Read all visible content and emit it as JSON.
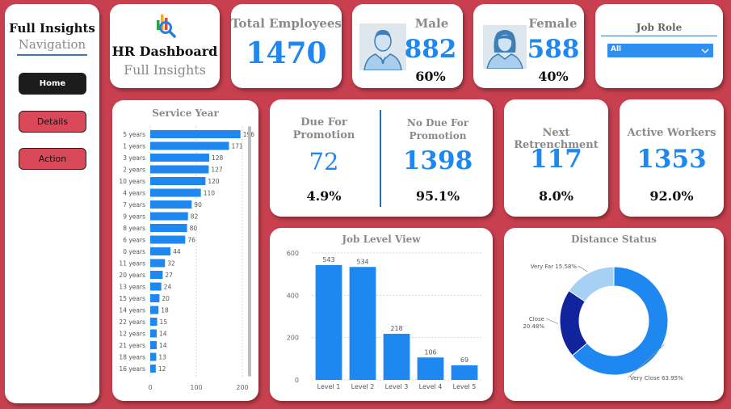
{
  "nav": {
    "title": "Full Insights",
    "subtitle": "Navigation",
    "buttons": [
      "Home",
      "Details",
      "Action"
    ]
  },
  "hr": {
    "title": "HR Dashboard",
    "subtitle": "Full Insights",
    "icon": "analytics-search-icon"
  },
  "total": {
    "label": "Total Employees",
    "value": "1470"
  },
  "male": {
    "label": "Male",
    "value": "882",
    "pct": "60%",
    "icon": "male-avatar-icon"
  },
  "female": {
    "label": "Female",
    "value": "588",
    "pct": "40%",
    "icon": "female-avatar-icon"
  },
  "jobrole": {
    "label": "Job Role",
    "selected": "All"
  },
  "promotion": {
    "due_label": "Due For Promotion",
    "due_value": "72",
    "due_pct": "4.9%",
    "nodue_label": "No Due For Promotion",
    "nodue_value": "1398",
    "nodue_pct": "95.1%"
  },
  "retrench": {
    "label": "Next Retrenchment",
    "value": "117",
    "pct": "8.0%"
  },
  "active": {
    "label": "Active Workers",
    "value": "1353",
    "pct": "92.0%"
  },
  "colors": {
    "accent": "#1e88f0",
    "background": "#c8404f",
    "dark_blue": "#12239e",
    "light_blue": "#a7d0f5"
  },
  "chart_data": [
    {
      "type": "bar",
      "orientation": "horizontal",
      "title": "Service Year",
      "categories": [
        "5 years",
        "1 years",
        "3 years",
        "2 years",
        "10 years",
        "4 years",
        "7 years",
        "9 years",
        "8 years",
        "6 years",
        "0 years",
        "11 years",
        "20 years",
        "13 years",
        "15 years",
        "14 years",
        "22 years",
        "12 years",
        "21 years",
        "18 years",
        "16 years"
      ],
      "values": [
        196,
        171,
        128,
        127,
        120,
        110,
        90,
        82,
        80,
        76,
        44,
        32,
        27,
        24,
        20,
        18,
        15,
        14,
        14,
        13,
        12
      ],
      "data_labels": [
        "196",
        "171",
        "128",
        "127",
        "120",
        "110",
        "90",
        "82",
        "80",
        "76",
        "44",
        "32",
        "27",
        "24",
        "20",
        "18",
        "15",
        "14",
        "14",
        "13",
        "12"
      ],
      "xlim": [
        0,
        200
      ],
      "xticks": [
        "0",
        "100",
        "200"
      ]
    },
    {
      "type": "bar",
      "title": "Job Level View",
      "categories": [
        "Level 1",
        "Level 2",
        "Level 3",
        "Level 4",
        "Level 5"
      ],
      "values": [
        543,
        534,
        218,
        106,
        69
      ],
      "ylim": [
        0,
        600
      ],
      "yticks": [
        "0",
        "200",
        "400",
        "600"
      ]
    },
    {
      "type": "pie",
      "title": "Distance Status",
      "donut": true,
      "slices": [
        {
          "label": "Very Close",
          "pct_text": "63.95%",
          "value": 63.95,
          "color": "#1e88f0"
        },
        {
          "label": "Close",
          "pct_text": "20.48%",
          "value": 20.48,
          "color": "#12239e"
        },
        {
          "label": "Very Far",
          "pct_text": "15.58%",
          "value": 15.58,
          "color": "#a7d0f5"
        }
      ]
    }
  ]
}
